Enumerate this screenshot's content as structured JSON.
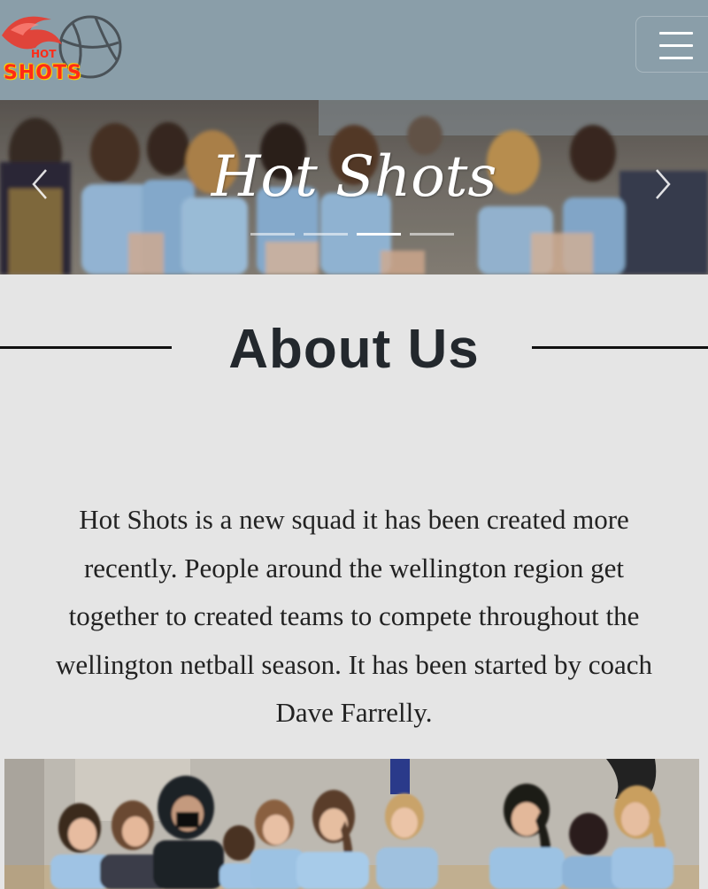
{
  "navbar": {
    "brand": {
      "line1": "HOT",
      "line2": "SHOTS"
    },
    "toggle_icon": "hamburger-menu-icon"
  },
  "carousel": {
    "title": "Hot Shots",
    "prev_icon": "chevron-left-icon",
    "next_icon": "chevron-right-icon",
    "slide_count": 4,
    "active_slide": 3
  },
  "about": {
    "title": "About Us",
    "lines": [
      "Hot Shots is a new squad it has been created more",
      "recently. People around the wellington region get",
      "together to created teams to compete throughout the",
      "wellington netball season. It has been started by coach",
      "Dave Farrelly."
    ]
  },
  "colors": {
    "navbar_bg": "#8a9ea9",
    "page_bg": "#e5e5e5",
    "heading_text": "#23282d",
    "logo_red": "#ff2b17",
    "logo_yellow": "#ffd400"
  }
}
